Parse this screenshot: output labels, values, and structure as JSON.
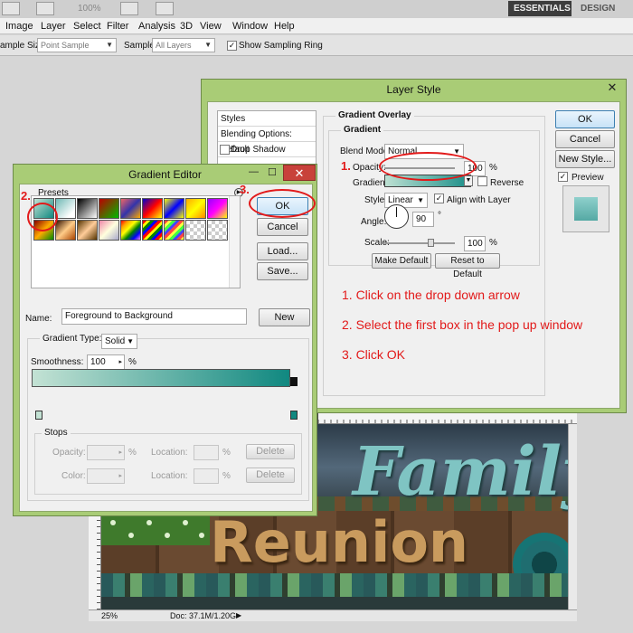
{
  "colors": {
    "dialog_frame": "#a9cc76",
    "annotation_red": "#e21a1a",
    "gradient_start": "#c3e2d4",
    "gradient_end": "#108880",
    "workspace_active": "#3d3d3d"
  },
  "topbar": {
    "zoom": "100%",
    "workspaces": {
      "essentials": "ESSENTIALS",
      "design": "DESIGN"
    }
  },
  "menu": {
    "items": [
      "Image",
      "Layer",
      "Select",
      "Filter",
      "Analysis",
      "3D",
      "View",
      "Window",
      "Help"
    ]
  },
  "options_bar": {
    "sample_size_label": "ample Size:",
    "sample_size_value": "Point Sample",
    "sample_label": "Sample:",
    "sample_value": "All Layers",
    "show_ring_label": "Show Sampling Ring"
  },
  "layer_style": {
    "title": "Layer Style",
    "list": {
      "header": "Styles",
      "blending": "Blending Options: Default",
      "drop_shadow": "Drop Shadow"
    },
    "section": "Gradient Overlay",
    "subsection": "Gradient",
    "blend_mode_label": "Blend Mode:",
    "blend_mode_value": "Normal",
    "opacity_label": "Opacity:",
    "opacity_value": "100",
    "percent": "%",
    "gradient_label": "Gradient:",
    "reverse_label": "Reverse",
    "style_label": "Style:",
    "style_value": "Linear",
    "align_label": "Align with Layer",
    "angle_label": "Angle:",
    "angle_value": "90",
    "degree": "°",
    "scale_label": "Scale:",
    "scale_value": "100",
    "make_default": "Make Default",
    "reset_default": "Reset to Default",
    "ok": "OK",
    "cancel": "Cancel",
    "new_style": "New Style...",
    "preview": "Preview"
  },
  "gradient_editor": {
    "title": "Gradient Editor",
    "presets_label": "Presets",
    "ok": "OK",
    "cancel": "Cancel",
    "load": "Load...",
    "save": "Save...",
    "name_label": "Name:",
    "name_value": "Foreground to Background",
    "new_button": "New",
    "gradient_type_label": "Gradient Type:",
    "gradient_type_value": "Solid",
    "smoothness_label": "Smoothness:",
    "smoothness_value": "100",
    "percent": "%",
    "stops_label": "Stops",
    "opacity_label": "Opacity:",
    "location_label": "Location:",
    "delete_label": "Delete",
    "color_label": "Color:"
  },
  "annotations": {
    "n1": "1.",
    "n2": "2.",
    "n3": "3.",
    "step1": "1. Click on the drop down arrow",
    "step2": "2. Select the first box in the pop up window",
    "step3": "3. Click OK"
  },
  "document": {
    "zoom": "25%",
    "doc_info": "Doc: 37.1M/1.20G",
    "word_family": "Family",
    "word_reunion": "Reunion"
  }
}
